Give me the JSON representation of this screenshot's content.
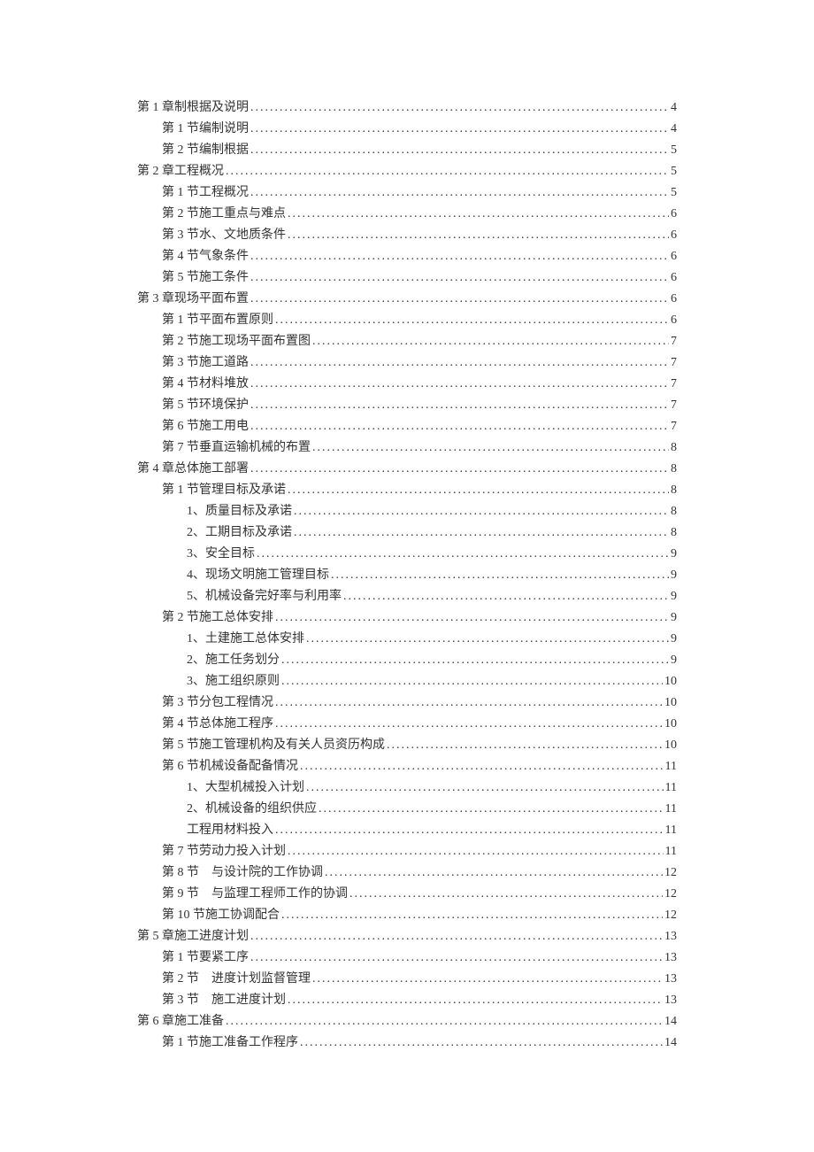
{
  "toc": [
    {
      "indent": 0,
      "label": "第 1 章制根据及说明",
      "page": "4"
    },
    {
      "indent": 1,
      "label": "第 1 节编制说明",
      "page": "4"
    },
    {
      "indent": 1,
      "label": "第 2 节编制根据",
      "page": "5"
    },
    {
      "indent": 0,
      "label": "第 2 章工程概况",
      "page": "5"
    },
    {
      "indent": 1,
      "label": "第 1 节工程概况",
      "page": "5"
    },
    {
      "indent": 1,
      "label": "第 2 节施工重点与难点",
      "page": "6"
    },
    {
      "indent": 1,
      "label": "第 3 节水、文地质条件",
      "page": "6"
    },
    {
      "indent": 1,
      "label": "第 4 节气象条件",
      "page": "6"
    },
    {
      "indent": 1,
      "label": "第 5 节施工条件",
      "page": "6"
    },
    {
      "indent": 0,
      "label": "第 3 章现场平面布置",
      "page": "6"
    },
    {
      "indent": 1,
      "label": "第 1 节平面布置原则",
      "page": "6"
    },
    {
      "indent": 1,
      "label": "第 2 节施工现场平面布置图",
      "page": "7"
    },
    {
      "indent": 1,
      "label": "第 3 节施工道路",
      "page": "7"
    },
    {
      "indent": 1,
      "label": "第 4 节材料堆放",
      "page": "7"
    },
    {
      "indent": 1,
      "label": "第 5 节环境保护",
      "page": "7"
    },
    {
      "indent": 1,
      "label": "第 6 节施工用电",
      "page": "7"
    },
    {
      "indent": 1,
      "label": "第 7 节垂直运输机械的布置",
      "page": "8"
    },
    {
      "indent": 0,
      "label": "第 4 章总体施工部署",
      "page": "8"
    },
    {
      "indent": 1,
      "label": "第 1 节管理目标及承诺",
      "page": "8"
    },
    {
      "indent": 2,
      "label": "1、质量目标及承诺",
      "page": "8"
    },
    {
      "indent": 2,
      "label": "2、工期目标及承诺",
      "page": "8"
    },
    {
      "indent": 2,
      "label": "3、安全目标",
      "page": "9"
    },
    {
      "indent": 2,
      "label": "4、现场文明施工管理目标",
      "page": "9"
    },
    {
      "indent": 2,
      "label": "5、机械设备完好率与利用率",
      "page": "9"
    },
    {
      "indent": 1,
      "label": "第 2 节施工总体安排",
      "page": "9"
    },
    {
      "indent": 2,
      "label": "1、土建施工总体安排",
      "page": "9"
    },
    {
      "indent": 2,
      "label": "2、施工任务划分",
      "page": "9"
    },
    {
      "indent": 2,
      "label": "3、施工组织原则",
      "page": "10"
    },
    {
      "indent": 1,
      "label": "第 3 节分包工程情况",
      "page": "10"
    },
    {
      "indent": 1,
      "label": "第 4 节总体施工程序",
      "page": "10"
    },
    {
      "indent": 1,
      "label": "第 5 节施工管理机构及有关人员资历构成",
      "page": "10"
    },
    {
      "indent": 1,
      "label": "第 6 节机械设备配备情况",
      "page": "11"
    },
    {
      "indent": 2,
      "label": "1、大型机械投入计划",
      "page": "11"
    },
    {
      "indent": 2,
      "label": "2、机械设备的组织供应",
      "page": "11"
    },
    {
      "indent": 2,
      "label": "工程用材料投入",
      "page": "11"
    },
    {
      "indent": 1,
      "label": "第 7 节劳动力投入计划",
      "page": "11"
    },
    {
      "indent": 1,
      "label": "第 8 节　与设计院的工作协调",
      "page": "12"
    },
    {
      "indent": 1,
      "label": "第 9 节　与监理工程师工作的协调",
      "page": "12"
    },
    {
      "indent": 1,
      "label": "第 10 节施工协调配合",
      "page": "12"
    },
    {
      "indent": 0,
      "label": "第 5 章施工进度计划",
      "page": "13"
    },
    {
      "indent": 1,
      "label": "第 1 节要紧工序",
      "page": "13"
    },
    {
      "indent": 1,
      "label": "第 2 节　进度计划监督管理",
      "page": "13"
    },
    {
      "indent": 1,
      "label": "第 3 节　施工进度计划",
      "page": "13"
    },
    {
      "indent": 0,
      "label": "第 6 章施工准备",
      "page": "14"
    },
    {
      "indent": 1,
      "label": "第 1 节施工准备工作程序",
      "page": "14"
    }
  ]
}
